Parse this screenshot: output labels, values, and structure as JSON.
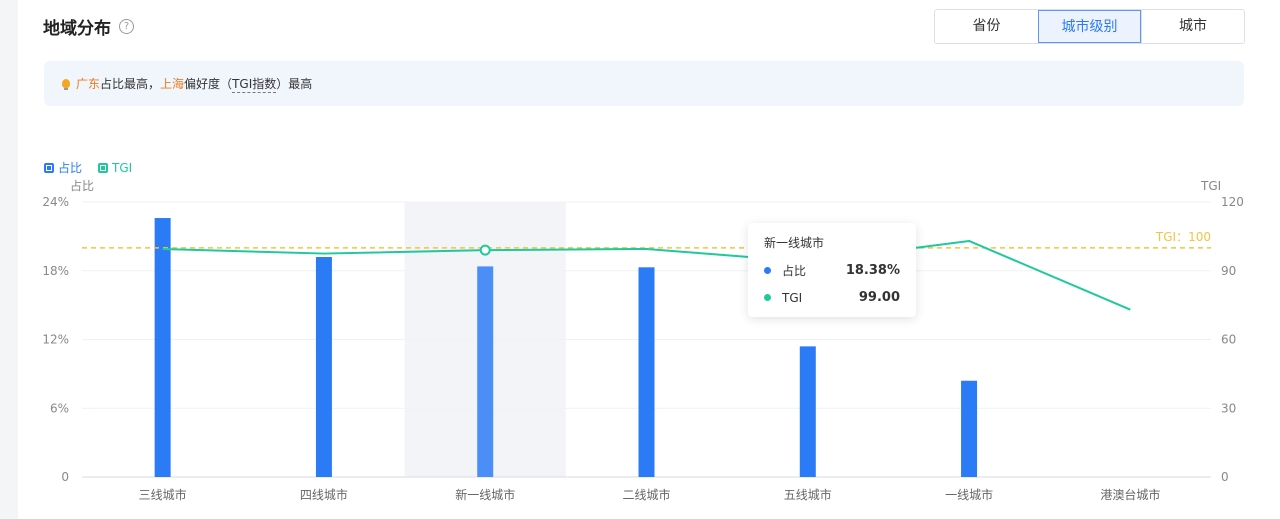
{
  "header": {
    "title": "地域分布",
    "help_icon": "?",
    "tabs": [
      {
        "label": "省份",
        "active": false
      },
      {
        "label": "城市级别",
        "active": true
      },
      {
        "label": "城市",
        "active": false
      }
    ]
  },
  "tip": {
    "region1": "广东",
    "text1": "占比最高，",
    "region2": "上海",
    "text2": "偏好度（",
    "tgi": "TGI指数",
    "text3": "）最高"
  },
  "colors": {
    "bar": "#2b7bf6",
    "bar_highlight": "#4b8ef8",
    "line": "#1ec99b",
    "reference": "#f5c242"
  },
  "chart_data": {
    "type": "bar",
    "categories": [
      "三线城市",
      "四线城市",
      "新一线城市",
      "二线城市",
      "五线城市",
      "一线城市",
      "港澳台城市"
    ],
    "series": [
      {
        "name": "占比",
        "type": "bar",
        "axis": "left",
        "values": [
          22.6,
          19.2,
          18.38,
          18.3,
          11.4,
          8.4,
          0
        ]
      },
      {
        "name": "TGI",
        "type": "line",
        "axis": "right",
        "values": [
          99.5,
          97.5,
          99.0,
          99.5,
          94.0,
          103.0,
          73.0
        ]
      }
    ],
    "ylabel_left": "占比",
    "ylabel_right": "TGI",
    "y_left_ticks": [
      "0",
      "6%",
      "12%",
      "18%",
      "24%"
    ],
    "y_right_ticks": [
      "0",
      "30",
      "60",
      "90",
      "120"
    ],
    "ylim_left": [
      0,
      24
    ],
    "ylim_right": [
      0,
      120
    ],
    "reference_line": {
      "value": 100,
      "label": "TGI：100"
    },
    "highlight_index": 2,
    "legend_position": "top-left",
    "grid": true
  },
  "tooltip": {
    "title": "新一线城市",
    "rows": [
      {
        "label": "占比",
        "value": "18.38%"
      },
      {
        "label": "TGI",
        "value": "99.00"
      }
    ]
  }
}
